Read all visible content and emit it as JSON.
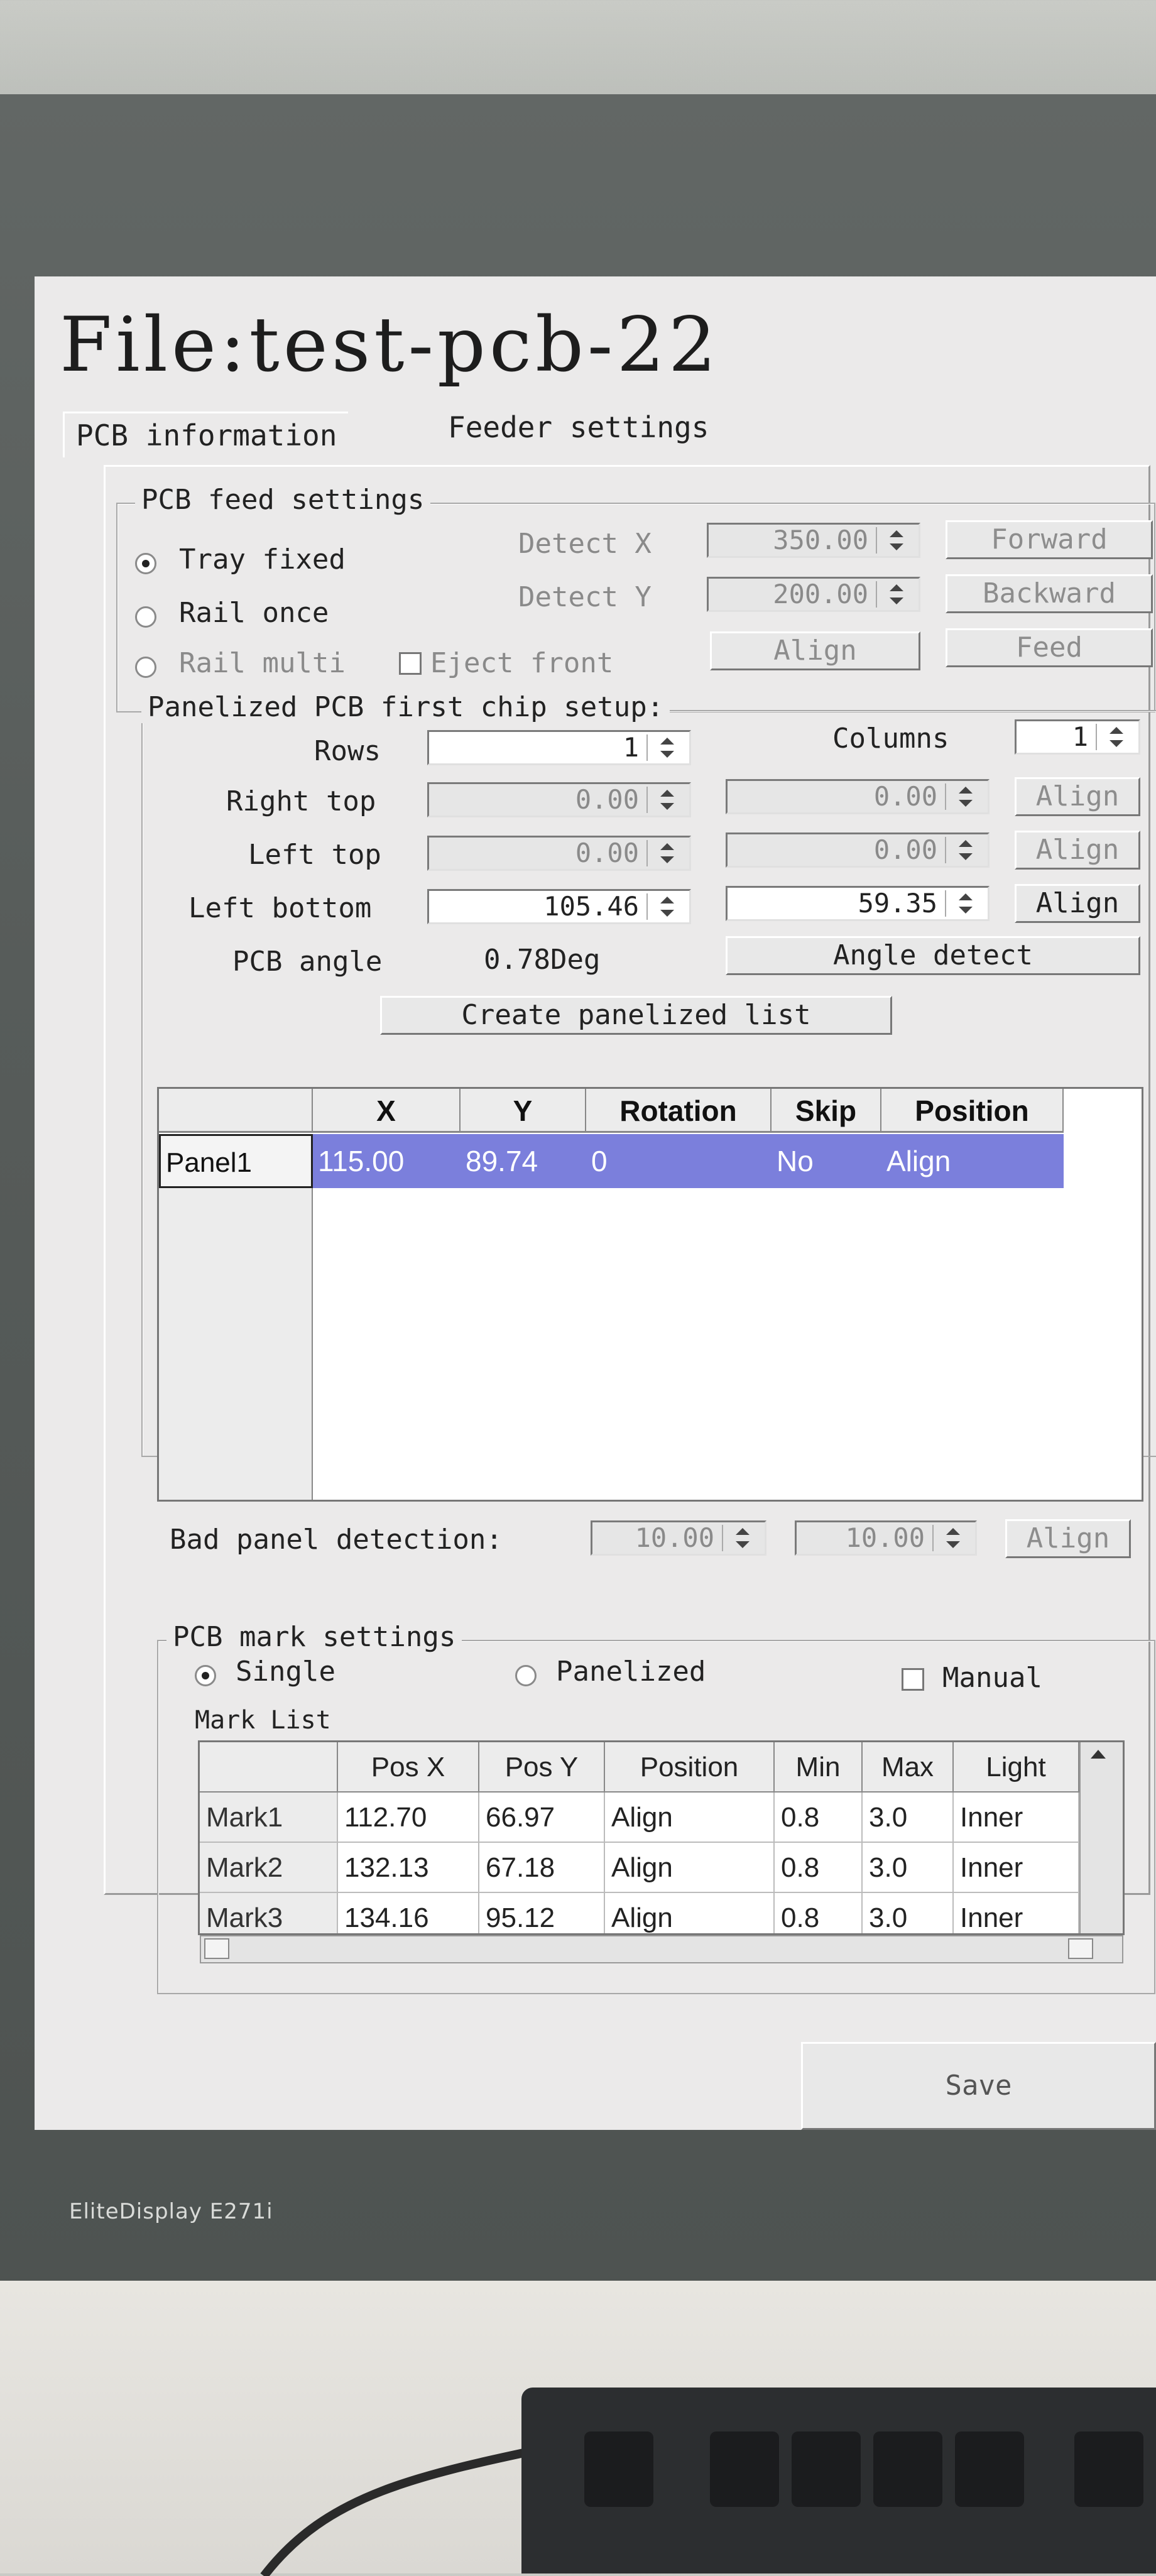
{
  "monitor": {
    "brand": "EliteDisplay E271i"
  },
  "window": {
    "title": "File:test-pcb-22",
    "tabs": [
      {
        "label": "PCB information",
        "active": true
      },
      {
        "label": "Feeder settings",
        "active": false
      }
    ]
  },
  "feed_settings": {
    "title": "PCB feed settings",
    "radios": [
      {
        "label": "Tray fixed",
        "selected": true
      },
      {
        "label": "Rail  once",
        "selected": false
      },
      {
        "label": "Rail multi",
        "selected": false
      }
    ],
    "eject_front_label": "Eject front",
    "detect_x_label": "Detect X",
    "detect_x_value": "350.00",
    "detect_y_label": "Detect Y",
    "detect_y_value": "200.00",
    "buttons": {
      "forward": "Forward",
      "backward": "Backward",
      "align": "Align",
      "feed": "Feed"
    }
  },
  "panelized": {
    "title": "Panelized PCB first chip setup:",
    "rows_label": "Rows",
    "rows_value": "1",
    "columns_label": "Columns",
    "columns_value": "1",
    "right_top_label": "Right top",
    "right_top_x": "0.00",
    "right_top_y": "0.00",
    "left_top_label": "Left top",
    "left_top_x": "0.00",
    "left_top_y": "0.00",
    "left_bottom_label": "Left bottom",
    "left_bottom_x": "105.46",
    "left_bottom_y": "59.35",
    "align_label": "Align",
    "pcb_angle_label": "PCB angle",
    "pcb_angle_value": "0.78Deg",
    "angle_detect_label": "Angle detect",
    "create_list_label": "Create panelized list",
    "table": {
      "headers": [
        "X",
        "Y",
        "Rotation",
        "Skip",
        "Position"
      ],
      "rows": [
        {
          "name": "Panel1",
          "x": "115.00",
          "y": "89.74",
          "rotation": "0",
          "skip": "No",
          "position": "Align"
        }
      ]
    },
    "bad_panel_label": "Bad panel detection:",
    "bad_panel_x": "10.00",
    "bad_panel_y": "10.00"
  },
  "mark_settings": {
    "title": "PCB mark settings",
    "modes": [
      {
        "label": "Single",
        "selected": true
      },
      {
        "label": "Panelized",
        "selected": false
      }
    ],
    "manual_label": "Manual",
    "list_label": "Mark List",
    "headers": [
      "Pos X",
      "Pos Y",
      "Position",
      "Min",
      "Max",
      "Light"
    ],
    "rows": [
      {
        "name": "Mark1",
        "pos_x": "112.70",
        "pos_y": "66.97",
        "position": "Align",
        "min": "0.8",
        "max": "3.0",
        "light": "Inner"
      },
      {
        "name": "Mark2",
        "pos_x": "132.13",
        "pos_y": "67.18",
        "position": "Align",
        "min": "0.8",
        "max": "3.0",
        "light": "Inner"
      },
      {
        "name": "Mark3",
        "pos_x": "134.16",
        "pos_y": "95.12",
        "position": "Align",
        "min": "0.8",
        "max": "3.0",
        "light": "Inner"
      }
    ]
  },
  "save_label": "Save",
  "colors": {
    "selection": "#7b7fdc",
    "screen_bg": "#ebeaea"
  }
}
